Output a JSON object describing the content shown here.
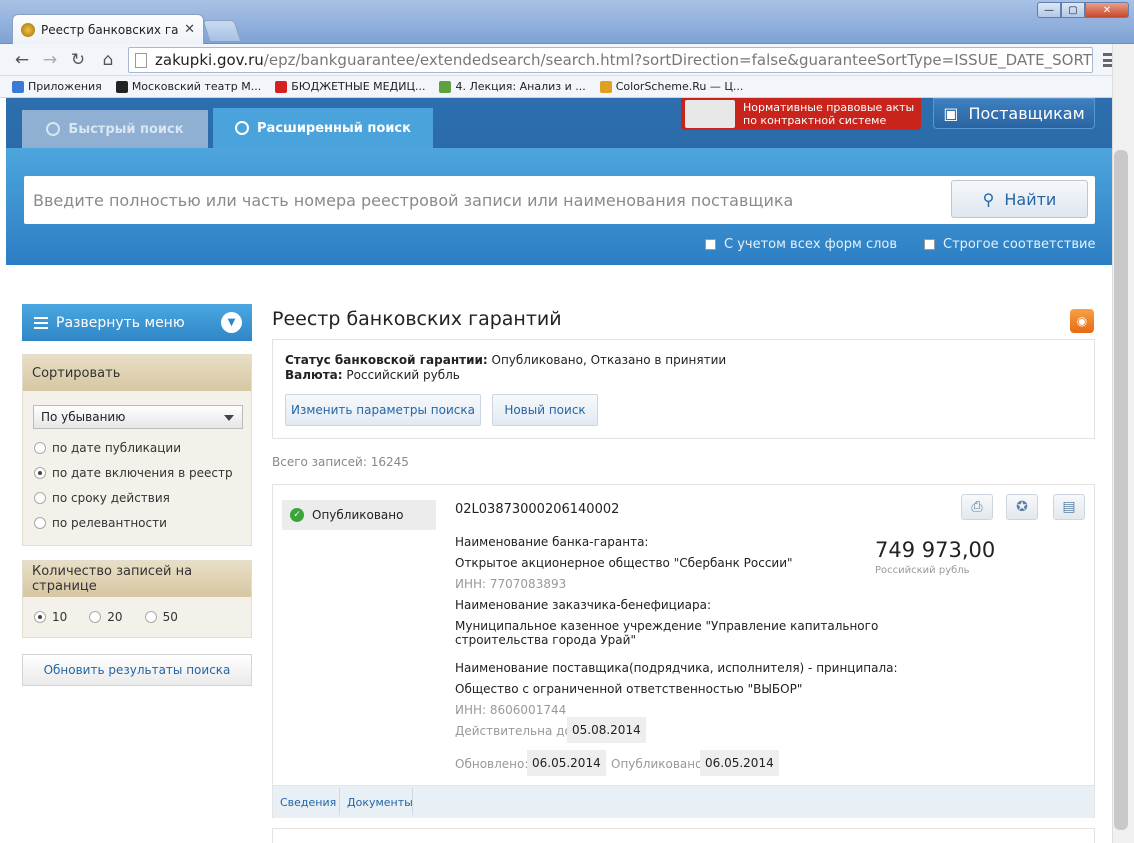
{
  "browser": {
    "tab_title": "Реестр банковских гарантий",
    "url_host": "zakupki.gov.ru",
    "url_path": "/epz/bankguarantee/extendedsearch/search.html?sortDirection=false&guaranteeSortType=ISSUE_DATE_SORT&re",
    "bookmarks": [
      {
        "label": "Приложения",
        "color": "#3b7bd8"
      },
      {
        "label": "Московский театр М...",
        "color": "#222222"
      },
      {
        "label": "БЮДЖЕТНЫЕ МЕДИЦ...",
        "color": "#d82020"
      },
      {
        "label": "4. Лекция: Анализ и ...",
        "color": "#5fa040"
      },
      {
        "label": "ColorScheme.Ru — Ц...",
        "color": "#e0a020"
      }
    ]
  },
  "header": {
    "tab_quick": "Быстрый поиск",
    "tab_extended": "Расширенный поиск",
    "banner_line1": "Нормативные правовые акты",
    "banner_line2": "по контрактной системе",
    "suppliers_button": "Поставщикам"
  },
  "search": {
    "placeholder": "Введите полностью или часть номера реестровой записи или наименования поставщика",
    "find_button": "Найти",
    "option_word_forms": "С учетом всех форм слов",
    "option_strict": "Строгое соответствие"
  },
  "sidebar": {
    "expand_menu": "Развернуть меню",
    "sort_title": "Сортировать",
    "sort_direction": "По убыванию",
    "sort_options": [
      "по дате публикации",
      "по дате включения в реестр",
      "по сроку действия",
      "по релевантности"
    ],
    "sort_selected": 1,
    "per_page_title": "Количество записей на странице",
    "per_page_options": [
      "10",
      "20",
      "50"
    ],
    "refresh_button": "Обновить результаты поиска"
  },
  "main": {
    "title": "Реестр банковских гарантий",
    "filter_status_label": "Статус банковской гарантии:",
    "filter_status_value": "Опубликовано, Отказано в принятии",
    "filter_currency_label": "Валюта:",
    "filter_currency_value": "Российский рубль",
    "change_params_button": "Изменить параметры поиска",
    "new_search_button": "Новый поиск",
    "total": "Всего записей: 16245"
  },
  "record": {
    "status": "Опубликовано",
    "number": "02L03873000206140002",
    "bank_label": "Наименование банка-гаранта:",
    "bank_name": "Открытое акционерное общество \"Сбербанк России\"",
    "bank_inn": "ИНН: 7707083893",
    "customer_label": "Наименование заказчика-бенефициара:",
    "customer_name_1": "Муниципальное казенное учреждение \"Управление капитального",
    "customer_name_2": "строительства города Урай\"",
    "supplier_label": "Наименование поставщика(подрядчика, исполнителя) - принципала:",
    "supplier_name": "Общество с ограниченной ответственностью \"ВЫБОР\"",
    "supplier_inn": "ИНН: 8606001744",
    "valid_label": "Действительна до:",
    "valid_date": "05.08.2014",
    "updated_label": "Обновлено:",
    "updated_date": "06.05.2014",
    "published_label": "Опубликовано:",
    "published_date": "06.05.2014",
    "amount": "749 973,00",
    "currency": "Российский рубль",
    "link_info": "Сведения",
    "link_docs": "Документы"
  }
}
